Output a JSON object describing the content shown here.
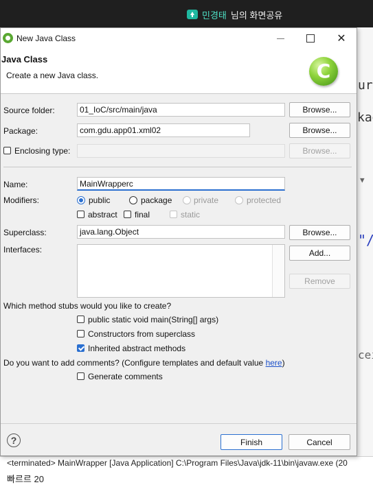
{
  "share_bar": {
    "name": "민경태",
    "rest": "님의 화면공유"
  },
  "background": {
    "console_line": "<terminated> MainWrapper [Java Application] C:\\Program Files\\Java\\jdk-11\\bin\\javaw.exe  (20",
    "console_line2": "빠르르 20",
    "ide_snippets": [
      "urc",
      "kag",
      "\"/",
      "cei"
    ]
  },
  "dialog": {
    "window_title": "New Java Class",
    "header_title": "Java Class",
    "header_desc": "Create a new Java class.",
    "icon_letter": "C",
    "source_folder": {
      "label": "Source folder:",
      "value": "01_IoC/src/main/java",
      "button": "Browse..."
    },
    "package": {
      "label": "Package:",
      "value": "com.gdu.app01.xml02",
      "button": "Browse..."
    },
    "enclosing": {
      "label": "Enclosing type:",
      "value": "",
      "button": "Browse..."
    },
    "name": {
      "label": "Name:",
      "value": "MainWrapperc"
    },
    "modifiers": {
      "label": "Modifiers:",
      "public": "public",
      "package": "package",
      "private": "private",
      "protected": "protected",
      "abstract": "abstract",
      "final": "final",
      "static": "static",
      "selected": "public"
    },
    "superclass": {
      "label": "Superclass:",
      "value": "java.lang.Object",
      "button": "Browse..."
    },
    "interfaces": {
      "label": "Interfaces:",
      "add": "Add...",
      "remove": "Remove"
    },
    "stubs": {
      "question": "Which method stubs would you like to create?",
      "main": "public static void main(String[] args)",
      "constructors": "Constructors from superclass",
      "inherited": "Inherited abstract methods",
      "main_checked": false,
      "constructors_checked": false,
      "inherited_checked": true
    },
    "comments": {
      "question": "Do you want to add comments? (Configure templates and default value ",
      "link": "here",
      "close_paren": ")",
      "generate": "Generate comments",
      "generate_checked": false
    },
    "footer": {
      "help": "?",
      "finish": "Finish",
      "cancel": "Cancel"
    }
  },
  "colors": {
    "accent": "#2a6fd0",
    "dialog_bg": "#f0f0f0",
    "share_bar": "#1f1f1f",
    "share_name": "#4ee0c4"
  }
}
